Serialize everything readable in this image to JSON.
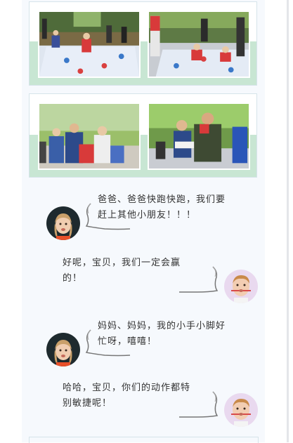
{
  "photos": [
    {
      "id": "hopscotch-kids-1",
      "description_icon": "photo"
    },
    {
      "id": "hopscotch-kids-2",
      "description_icon": "photo"
    },
    {
      "id": "family-race-1",
      "description_icon": "photo"
    },
    {
      "id": "family-race-2",
      "description_icon": "photo"
    }
  ],
  "chat": [
    {
      "speaker": "girl",
      "side": "left",
      "text_line1": "爸爸、爸爸快跑快跑，我们要",
      "text_line2": "赶上其他小朋友！！！"
    },
    {
      "speaker": "boy",
      "side": "right",
      "text_line1": "好呢，宝贝，我们一定会赢",
      "text_line2": "的！"
    },
    {
      "speaker": "girl",
      "side": "left",
      "text_line1": "妈妈、妈妈，我的小手小脚好",
      "text_line2": "忙呀，嘻嘻！"
    },
    {
      "speaker": "boy",
      "side": "right",
      "text_line1": "哈哈，宝贝，你们的动作都特",
      "text_line2": "别敏捷呢！"
    }
  ],
  "colors": {
    "band": "#c8e6d3",
    "page_bg": "#f6f9fd",
    "text": "#333333"
  }
}
